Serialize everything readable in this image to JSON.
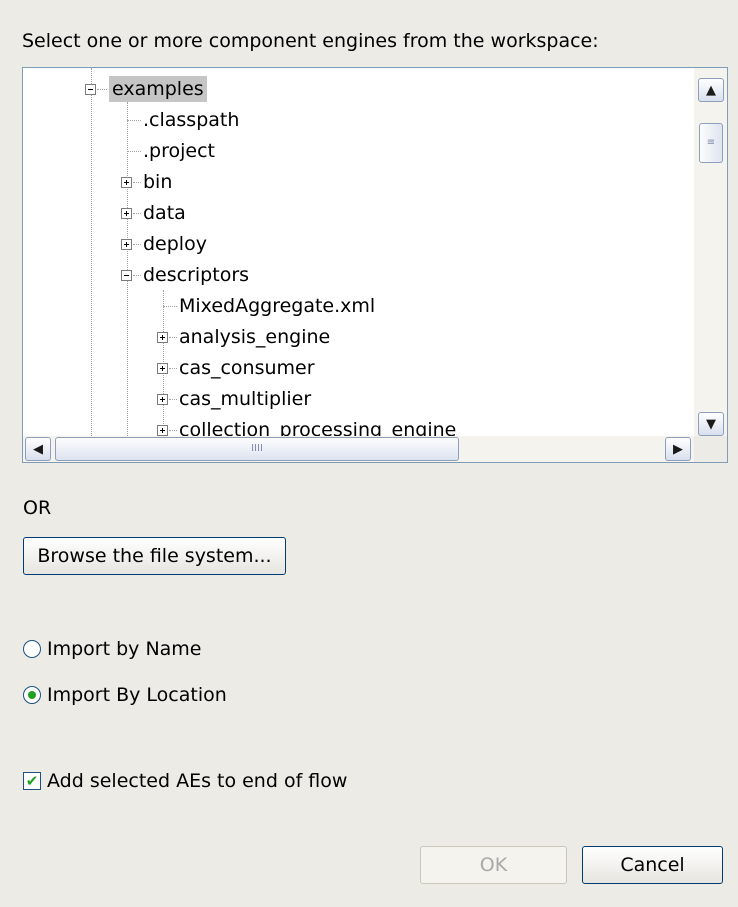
{
  "prompt": "Select one or more component engines from the workspace:",
  "tree": {
    "items": [
      {
        "label": "examples",
        "selected": true,
        "expander": "minus"
      },
      {
        "label": ".classpath",
        "expander": "none"
      },
      {
        "label": ".project",
        "expander": "none"
      },
      {
        "label": "bin",
        "expander": "plus"
      },
      {
        "label": "data",
        "expander": "plus"
      },
      {
        "label": "deploy",
        "expander": "plus"
      },
      {
        "label": "descriptors",
        "expander": "minus"
      },
      {
        "label": "MixedAggregate.xml",
        "expander": "none"
      },
      {
        "label": "analysis_engine",
        "expander": "plus"
      },
      {
        "label": "cas_consumer",
        "expander": "plus"
      },
      {
        "label": "cas_multiplier",
        "expander": "plus"
      },
      {
        "label": "collection_processing_engine",
        "expander": "plus"
      }
    ],
    "vscroll": {
      "up_icon": "chevron-up-icon",
      "down_icon": "chevron-down-icon",
      "grip": "≡"
    },
    "hscroll": {
      "left_icon": "chevron-left-icon",
      "right_icon": "chevron-right-icon",
      "grip": "IIII"
    }
  },
  "or_label": "OR",
  "browse_button": "Browse the file system...",
  "import_options": [
    {
      "label": "Import by Name",
      "selected": false
    },
    {
      "label": "Import By Location",
      "selected": true
    }
  ],
  "add_to_flow": {
    "label": "Add selected AEs to end of flow",
    "checked": true
  },
  "ok_button": "OK",
  "cancel_button": "Cancel",
  "colors": {
    "selection": "#c5c5c5",
    "border": "#7f9db9",
    "accent_green": "#21a121"
  }
}
